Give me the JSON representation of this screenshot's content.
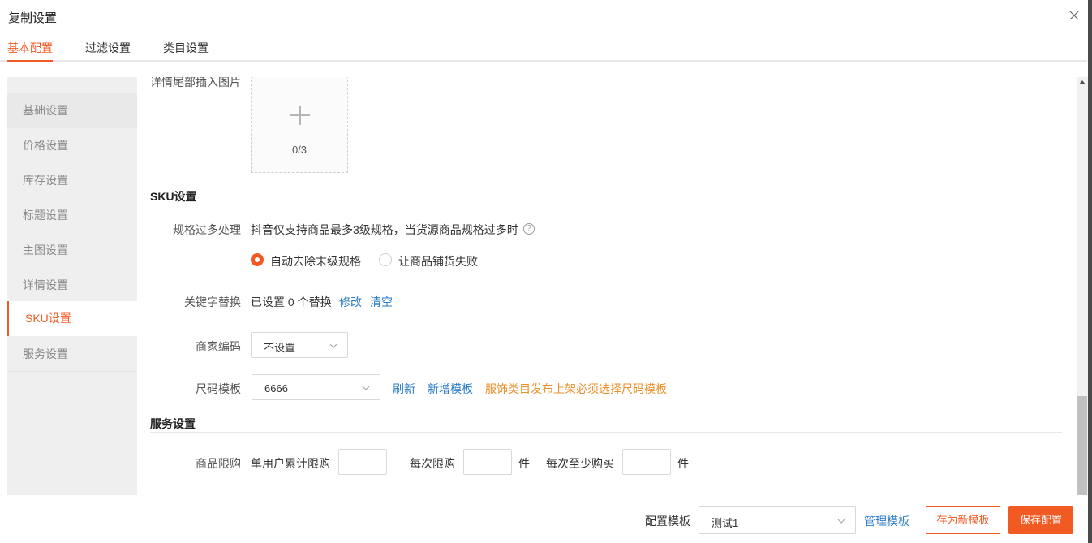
{
  "dialog": {
    "title": "复制设置"
  },
  "tabs": [
    {
      "label": "基本配置",
      "active": true
    },
    {
      "label": "过滤设置",
      "active": false
    },
    {
      "label": "类目设置",
      "active": false
    }
  ],
  "sidebar": {
    "items": [
      {
        "label": "基础设置"
      },
      {
        "label": "价格设置"
      },
      {
        "label": "库存设置"
      },
      {
        "label": "标题设置"
      },
      {
        "label": "主图设置"
      },
      {
        "label": "详情设置"
      },
      {
        "label": "SKU设置",
        "active": true
      },
      {
        "label": "服务设置"
      }
    ]
  },
  "detail_tail": {
    "label": "详情尾部插入图片",
    "upload_count": "0/3"
  },
  "sku_section": {
    "title": "SKU设置",
    "spec_overflow": {
      "label": "规格过多处理",
      "description": "抖音仅支持商品最多3级规格，当货源商品规格过多时",
      "help": "?",
      "options": [
        {
          "label": "自动去除末级规格",
          "checked": true
        },
        {
          "label": "让商品铺货失败",
          "checked": false
        }
      ]
    },
    "keyword_replace": {
      "label": "关键字替换",
      "status": "已设置 0 个替换",
      "edit_link": "修改",
      "clear_link": "清空"
    },
    "merchant_code": {
      "label": "商家编码",
      "value": "不设置"
    },
    "size_template": {
      "label": "尺码模板",
      "value": "6666",
      "refresh_link": "刷新",
      "add_link": "新增模板",
      "notice": "服饰类目发布上架必须选择尺码模板"
    }
  },
  "service_section": {
    "title": "服务设置",
    "purchase_limit": {
      "label": "商品限购",
      "cumulative_label": "单用户累计限购",
      "per_order_label": "每次限购",
      "per_order_unit": "件",
      "min_buy_label": "每次至少购买",
      "min_buy_unit": "件"
    }
  },
  "footer": {
    "template_label": "配置模板",
    "template_value": "测试1",
    "manage_link": "管理模板",
    "save_new_button": "存为新模板",
    "save_button": "保存配置"
  },
  "colors": {
    "accent": "#f25a24",
    "link": "#2c7ec4",
    "warning": "#e8902a"
  }
}
